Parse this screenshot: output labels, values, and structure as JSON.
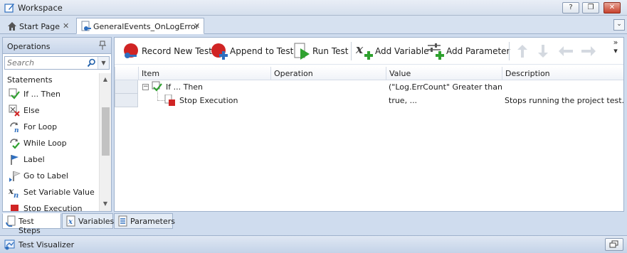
{
  "window": {
    "title": "Workspace",
    "buttons": {
      "help": "?",
      "restore": "❐",
      "close": "✕"
    }
  },
  "tabs": [
    {
      "label": "Start Page",
      "icon": "home-icon",
      "close": "✕"
    },
    {
      "label": "GeneralEvents_OnLogError",
      "icon": "event-handler-icon",
      "close": "✕",
      "active": true
    }
  ],
  "tab_dropdown": "⌄",
  "operations": {
    "title": "Operations",
    "search_placeholder": "Search",
    "group": "Statements",
    "items": [
      {
        "label": "If ... Then",
        "icon": "if-then-icon"
      },
      {
        "label": "Else",
        "icon": "else-icon"
      },
      {
        "label": "For Loop",
        "icon": "for-loop-icon"
      },
      {
        "label": "While Loop",
        "icon": "while-loop-icon"
      },
      {
        "label": "Label",
        "icon": "label-flag-icon"
      },
      {
        "label": "Go to Label",
        "icon": "goto-label-icon"
      },
      {
        "label": "Set Variable Value",
        "icon": "set-variable-icon"
      },
      {
        "label": "Stop Execution",
        "icon": "stop-execution-icon"
      }
    ]
  },
  "bottom_tabs": [
    {
      "label": "Test Steps",
      "icon": "test-steps-icon",
      "active": true
    },
    {
      "label": "Variables",
      "icon": "variables-icon"
    },
    {
      "label": "Parameters",
      "icon": "parameters-icon"
    }
  ],
  "toolbar": {
    "record": "Record New Test",
    "append": "Append to Test",
    "run": "Run Test",
    "add_variable": "Add Variable",
    "add_parameter": "Add Parameter",
    "more": "»"
  },
  "grid": {
    "columns": [
      "Item",
      "Operation",
      "Value",
      "Description"
    ],
    "rows": [
      {
        "expander": "−",
        "item": "If ... Then",
        "operation": "",
        "value": "(\"Log.ErrCount\" Greater than ...",
        "description": ""
      },
      {
        "item": "Stop Execution",
        "operation": "",
        "value": "true, ...",
        "description": "Stops running the project test..."
      }
    ]
  },
  "visualizer": {
    "title": "Test Visualizer"
  },
  "colors": {
    "accent": "#2f6fbf",
    "record_red": "#d02424",
    "run_green": "#2fa12f",
    "panel_bg": "#cfdcee"
  }
}
